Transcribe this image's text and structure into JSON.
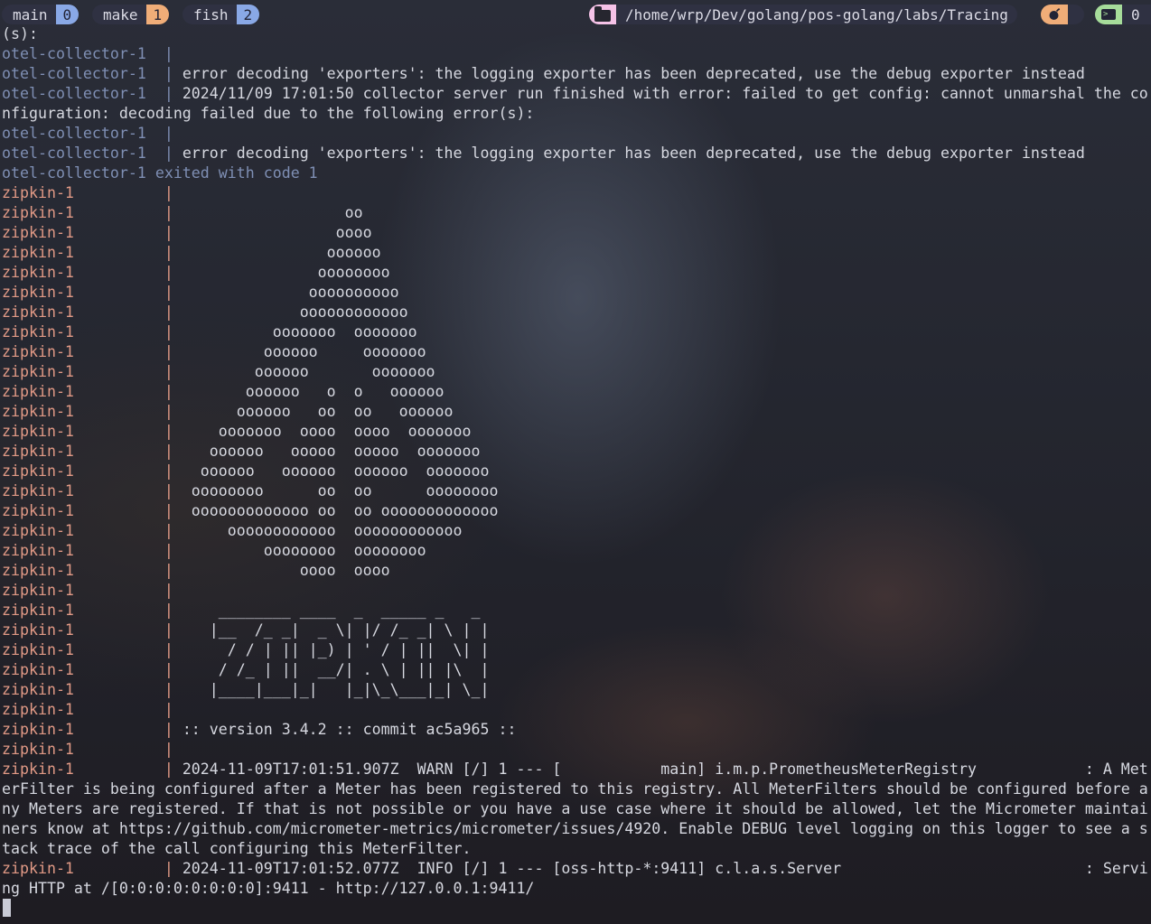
{
  "statusbar": {
    "sessions": [
      {
        "name": "main",
        "count": "0"
      },
      {
        "name": "make",
        "count": "1"
      },
      {
        "name": "fish",
        "count": "2"
      }
    ],
    "path": "/home/wrp/Dev/golang/pos-golang/labs/Tracing",
    "folder_icon": "folder-icon",
    "bomb_icon": "bomb-icon",
    "terminal_icon": "terminal-icon",
    "terminal_count": "0"
  },
  "terminal": {
    "lines": [
      {
        "kind": "msg",
        "text": "(s):"
      },
      {
        "kind": "otel",
        "svc": "otel-collector-1  |",
        "text": ""
      },
      {
        "kind": "otel",
        "svc": "otel-collector-1  |",
        "text": " error decoding 'exporters': the logging exporter has been deprecated, use the debug exporter instead"
      },
      {
        "kind": "otel",
        "svc": "otel-collector-1  |",
        "text": " 2024/11/09 17:01:50 collector server run finished with error: failed to get config: cannot unmarshal the co"
      },
      {
        "kind": "msg",
        "text": "nfiguration: decoding failed due to the following error(s):"
      },
      {
        "kind": "otel",
        "svc": "otel-collector-1  |",
        "text": ""
      },
      {
        "kind": "otel",
        "svc": "otel-collector-1  |",
        "text": " error decoding 'exporters': the logging exporter has been deprecated, use the debug exporter instead"
      },
      {
        "kind": "exit",
        "text": "otel-collector-1 exited with code 1"
      },
      {
        "kind": "zip",
        "svc": "zipkin-1          |",
        "text": ""
      },
      {
        "kind": "zip",
        "svc": "zipkin-1          |",
        "text": "                   oo"
      },
      {
        "kind": "zip",
        "svc": "zipkin-1          |",
        "text": "                  oooo"
      },
      {
        "kind": "zip",
        "svc": "zipkin-1          |",
        "text": "                 oooooo"
      },
      {
        "kind": "zip",
        "svc": "zipkin-1          |",
        "text": "                oooooooo"
      },
      {
        "kind": "zip",
        "svc": "zipkin-1          |",
        "text": "               oooooooooo"
      },
      {
        "kind": "zip",
        "svc": "zipkin-1          |",
        "text": "              oooooooooooo"
      },
      {
        "kind": "zip",
        "svc": "zipkin-1          |",
        "text": "           ooooooo  ooooooo"
      },
      {
        "kind": "zip",
        "svc": "zipkin-1          |",
        "text": "          oooooo     ooooooo"
      },
      {
        "kind": "zip",
        "svc": "zipkin-1          |",
        "text": "         oooooo       ooooooo"
      },
      {
        "kind": "zip",
        "svc": "zipkin-1          |",
        "text": "        oooooo   o  o   oooooo"
      },
      {
        "kind": "zip",
        "svc": "zipkin-1          |",
        "text": "       oooooo   oo  oo   oooooo"
      },
      {
        "kind": "zip",
        "svc": "zipkin-1          |",
        "text": "     ooooooo  oooo  oooo  ooooooo"
      },
      {
        "kind": "zip",
        "svc": "zipkin-1          |",
        "text": "    oooooo   ooooo  ooooo  ooooooo"
      },
      {
        "kind": "zip",
        "svc": "zipkin-1          |",
        "text": "   oooooo   oooooo  oooooo  ooooooo"
      },
      {
        "kind": "zip",
        "svc": "zipkin-1          |",
        "text": "  oooooooo      oo  oo      oooooooo"
      },
      {
        "kind": "zip",
        "svc": "zipkin-1          |",
        "text": "  ooooooooooooo oo  oo ooooooooooooo"
      },
      {
        "kind": "zip",
        "svc": "zipkin-1          |",
        "text": "      oooooooooooo  oooooooooooo"
      },
      {
        "kind": "zip",
        "svc": "zipkin-1          |",
        "text": "          oooooooo  oooooooo"
      },
      {
        "kind": "zip",
        "svc": "zipkin-1          |",
        "text": "              oooo  oooo"
      },
      {
        "kind": "zip",
        "svc": "zipkin-1          |",
        "text": ""
      },
      {
        "kind": "zip",
        "svc": "zipkin-1          |",
        "text": "     ________ ____  _  _____ _   _"
      },
      {
        "kind": "zip",
        "svc": "zipkin-1          |",
        "text": "    |__  /_ _|  _ \\| |/ /_ _| \\ | |"
      },
      {
        "kind": "zip",
        "svc": "zipkin-1          |",
        "text": "      / / | || |_) | ' / | ||  \\| |"
      },
      {
        "kind": "zip",
        "svc": "zipkin-1          |",
        "text": "     / /_ | ||  __/| . \\ | || |\\  |"
      },
      {
        "kind": "zip",
        "svc": "zipkin-1          |",
        "text": "    |____|___|_|   |_|\\_\\___|_| \\_|"
      },
      {
        "kind": "zip",
        "svc": "zipkin-1          |",
        "text": ""
      },
      {
        "kind": "zip",
        "svc": "zipkin-1          |",
        "text": " :: version 3.4.2 :: commit ac5a965 ::"
      },
      {
        "kind": "zip",
        "svc": "zipkin-1          |",
        "text": ""
      },
      {
        "kind": "zip",
        "svc": "zipkin-1          |",
        "text": " 2024-11-09T17:01:51.907Z  WARN [/] 1 --- [           main] i.m.p.PrometheusMeterRegistry            : A Met"
      },
      {
        "kind": "msg",
        "text": "erFilter is being configured after a Meter has been registered to this registry. All MeterFilters should be configured before a"
      },
      {
        "kind": "msg",
        "text": "ny Meters are registered. If that is not possible or you have a use case where it should be allowed, let the Micrometer maintai"
      },
      {
        "kind": "msg",
        "text": "ners know at https://github.com/micrometer-metrics/micrometer/issues/4920. Enable DEBUG level logging on this logger to see a s"
      },
      {
        "kind": "msg",
        "text": "tack trace of the call configuring this MeterFilter."
      },
      {
        "kind": "zip",
        "svc": "zipkin-1          |",
        "text": " 2024-11-09T17:01:52.077Z  INFO [/] 1 --- [oss-http-*:9411] c.l.a.s.Server                           : Servi"
      },
      {
        "kind": "msg",
        "text": "ng HTTP at /[0:0:0:0:0:0:0:0]:9411 - http://127.0.0.1:9411/"
      }
    ]
  },
  "colors": {
    "otel_service": "#7f8fb4",
    "zipkin_service": "#e29a86",
    "text": "#d6d8e0",
    "accent_blue": "#89a8e6",
    "accent_orange": "#f0ad78",
    "accent_pink": "#f5c2e7",
    "accent_green": "#a6dc9a"
  }
}
